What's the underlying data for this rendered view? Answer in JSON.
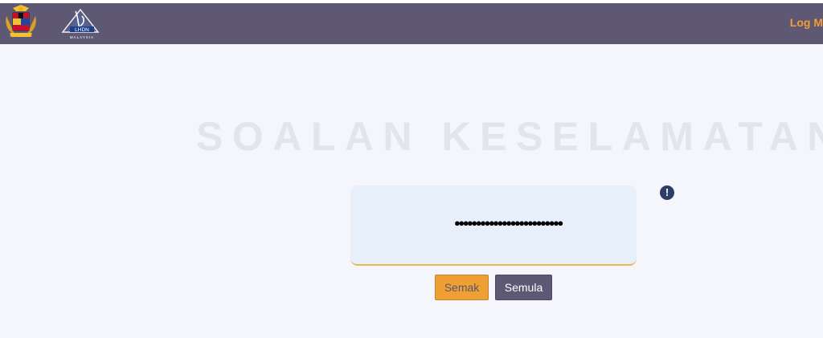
{
  "header": {
    "logo_lhdn_text": "LHDN",
    "logo_lhdn_subtext": "MALAYSIA",
    "logout_label": "Log M"
  },
  "main": {
    "title": "SOALAN KESELAMATAN",
    "answer_masked": "●●●●●●●●●●●●●●●●●●●●●●●●●",
    "info_symbol": "!",
    "check_button": "Semak",
    "reset_button": "Semula"
  },
  "colors": {
    "header_bg": "#5e5875",
    "accent_orange": "#f0a032",
    "page_bg": "#f4f6fb"
  }
}
